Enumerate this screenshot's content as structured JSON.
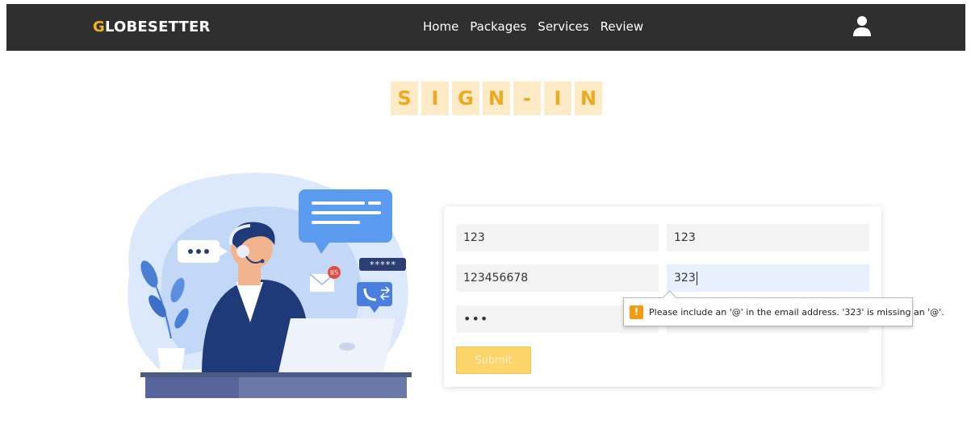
{
  "nav": {
    "logo_first": "G",
    "logo_rest": "LOBESETTER",
    "links": [
      "Home",
      "Packages",
      "Services",
      "Review"
    ]
  },
  "title": [
    "S",
    "I",
    "G",
    "N",
    "-",
    "I",
    "N"
  ],
  "form": {
    "field1": "123",
    "field2": "123",
    "field3": "123456678",
    "field4": "323",
    "field5": "•••",
    "submit": "Submit"
  },
  "tooltip": {
    "icon": "!",
    "message": "Please include an '@' in the email address. '323' is missing an '@'."
  },
  "illustration": {
    "password_badge": "*****",
    "notification_count": "85"
  },
  "colors": {
    "accent": "#f6b21b",
    "nav_bg": "#2f2f2f",
    "illustration_blue": "#4a90e2"
  }
}
